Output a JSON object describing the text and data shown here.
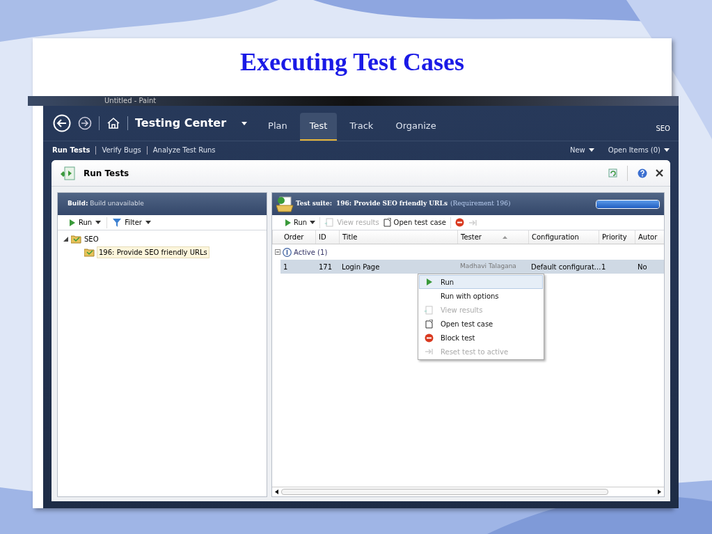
{
  "slide": {
    "title": "Executing Test Cases"
  },
  "background_window": {
    "title": "Untitled - Paint"
  },
  "nav": {
    "title": "Testing Center",
    "user": "SEO",
    "tabs": [
      {
        "label": "Plan",
        "selected": false
      },
      {
        "label": "Test",
        "selected": true
      },
      {
        "label": "Track",
        "selected": false
      },
      {
        "label": "Organize",
        "selected": false
      }
    ]
  },
  "subnav": {
    "items": [
      {
        "label": "Run Tests",
        "selected": true
      },
      {
        "label": "Verify Bugs",
        "selected": false
      },
      {
        "label": "Analyze Test Runs",
        "selected": false
      }
    ],
    "menus": [
      "New",
      "Open Items (0)"
    ]
  },
  "panel": {
    "title": "Run Tests"
  },
  "left": {
    "build_label": "Build:",
    "build_value": "Build unavailable",
    "toolbar": [
      {
        "kind": "run",
        "label": "Run"
      },
      {
        "kind": "filter",
        "label": "Filter"
      }
    ],
    "tree": [
      {
        "label": "SEO",
        "expanded": true,
        "selected": false,
        "children": [
          {
            "label": "196: Provide SEO friendly URLs",
            "selected": true
          }
        ]
      }
    ]
  },
  "right": {
    "suite_label": "Test suite:",
    "suite_name": "196: Provide SEO friendly URLs",
    "suite_note": "(Requirement 196)",
    "progress": {
      "level": 1
    },
    "toolbar": [
      {
        "kind": "run",
        "label": "Run",
        "disabled": false
      },
      {
        "kind": "results",
        "label": "View results",
        "disabled": true
      },
      {
        "kind": "open",
        "label": "Open test case",
        "disabled": false
      },
      {
        "kind": "block",
        "disabled": false
      },
      {
        "kind": "reset",
        "disabled": true
      }
    ],
    "columns": [
      "Order",
      "ID",
      "Title",
      "Tester",
      "Configuration",
      "Priority",
      "Autor"
    ],
    "groups": [
      {
        "label": "Active (1)",
        "expanded": true,
        "rows": [
          {
            "selected": true,
            "cells": [
              "1",
              "171",
              "Login Page",
              "Madhavi Talagana",
              "Default configurat...",
              "1",
              "No"
            ]
          }
        ]
      }
    ]
  },
  "context_menu": [
    {
      "kind": "run",
      "label": "Run",
      "disabled": false,
      "selected": true
    },
    {
      "kind": "none",
      "label": "Run with options",
      "disabled": false,
      "selected": false
    },
    {
      "kind": "results",
      "label": "View results",
      "disabled": true,
      "selected": false
    },
    {
      "kind": "open",
      "label": "Open test case",
      "disabled": false,
      "selected": false
    },
    {
      "kind": "block",
      "label": "Block test",
      "disabled": false,
      "selected": false
    },
    {
      "kind": "reset",
      "label": "Reset test to active",
      "disabled": true,
      "selected": false
    }
  ]
}
